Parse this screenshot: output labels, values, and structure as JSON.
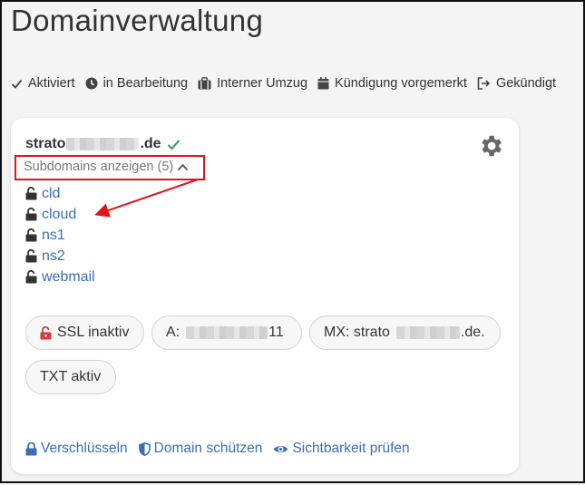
{
  "page": {
    "title": "Domainverwaltung"
  },
  "legend": [
    {
      "label": "Aktiviert",
      "icon": "check-icon"
    },
    {
      "label": "in Bearbeitung",
      "icon": "clock-icon"
    },
    {
      "label": "Interner Umzug",
      "icon": "suitcase-icon"
    },
    {
      "label": "Kündigung vorgemerkt",
      "icon": "calendar-icon"
    },
    {
      "label": "Gekündigt",
      "icon": "sign-out-icon"
    }
  ],
  "domain_card": {
    "name_prefix": "strato",
    "name_suffix": ".de",
    "status_color": "#2e9e5b",
    "subdomains_toggle": "Subdomains anzeigen (5)",
    "subdomains": [
      "cld",
      "cloud",
      "ns1",
      "ns2",
      "webmail"
    ],
    "chips": {
      "ssl": "SSL inaktiv",
      "a_prefix": "A:",
      "a_suffix": "11",
      "mx_prefix": "MX: strato",
      "mx_suffix": ".de.",
      "txt": "TXT aktiv"
    },
    "actions": {
      "encrypt": "Verschlüsseln",
      "protect": "Domain schützen",
      "visibility": "Sichtbarkeit prüfen"
    }
  },
  "colors": {
    "link": "#3a6eb5",
    "annotation": "#e0151b",
    "ssl_lock": "#d9363e"
  }
}
